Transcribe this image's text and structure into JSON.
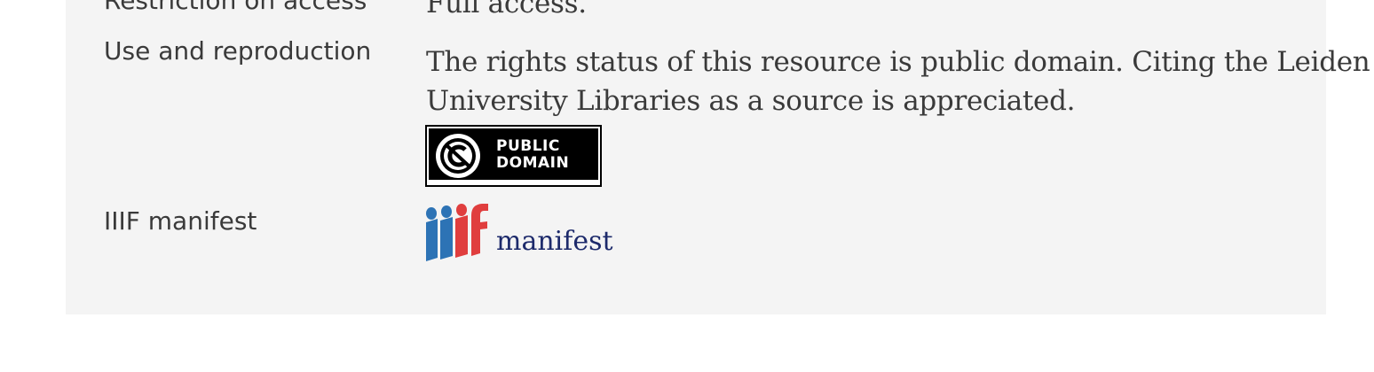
{
  "metadata": {
    "rows": [
      {
        "label": "Restriction on access",
        "value": "Full access."
      },
      {
        "label": "Use and reproduction",
        "value": "The rights status of this resource is public domain. Citing the Leiden University Libraries as a source is appreciated.",
        "value_line1": "The rights status of this resource is public domain. Citing the Leiden",
        "value_line2": "University Libraries as a source is appreciated."
      },
      {
        "label": "IIIF manifest",
        "value": "manifest"
      }
    ]
  },
  "badges": {
    "public_domain": {
      "line1": "PUBLIC",
      "line2": "DOMAIN",
      "icon": "public-domain-icon"
    },
    "iiif": {
      "icon": "iiif-logo-icon",
      "colors": {
        "blue": "#2d73b5",
        "red": "#e03e3e"
      }
    }
  },
  "colors": {
    "panel_background": "#f4f4f4",
    "text": "#3a3a3a",
    "link_dark_blue": "#1d2a6b"
  }
}
